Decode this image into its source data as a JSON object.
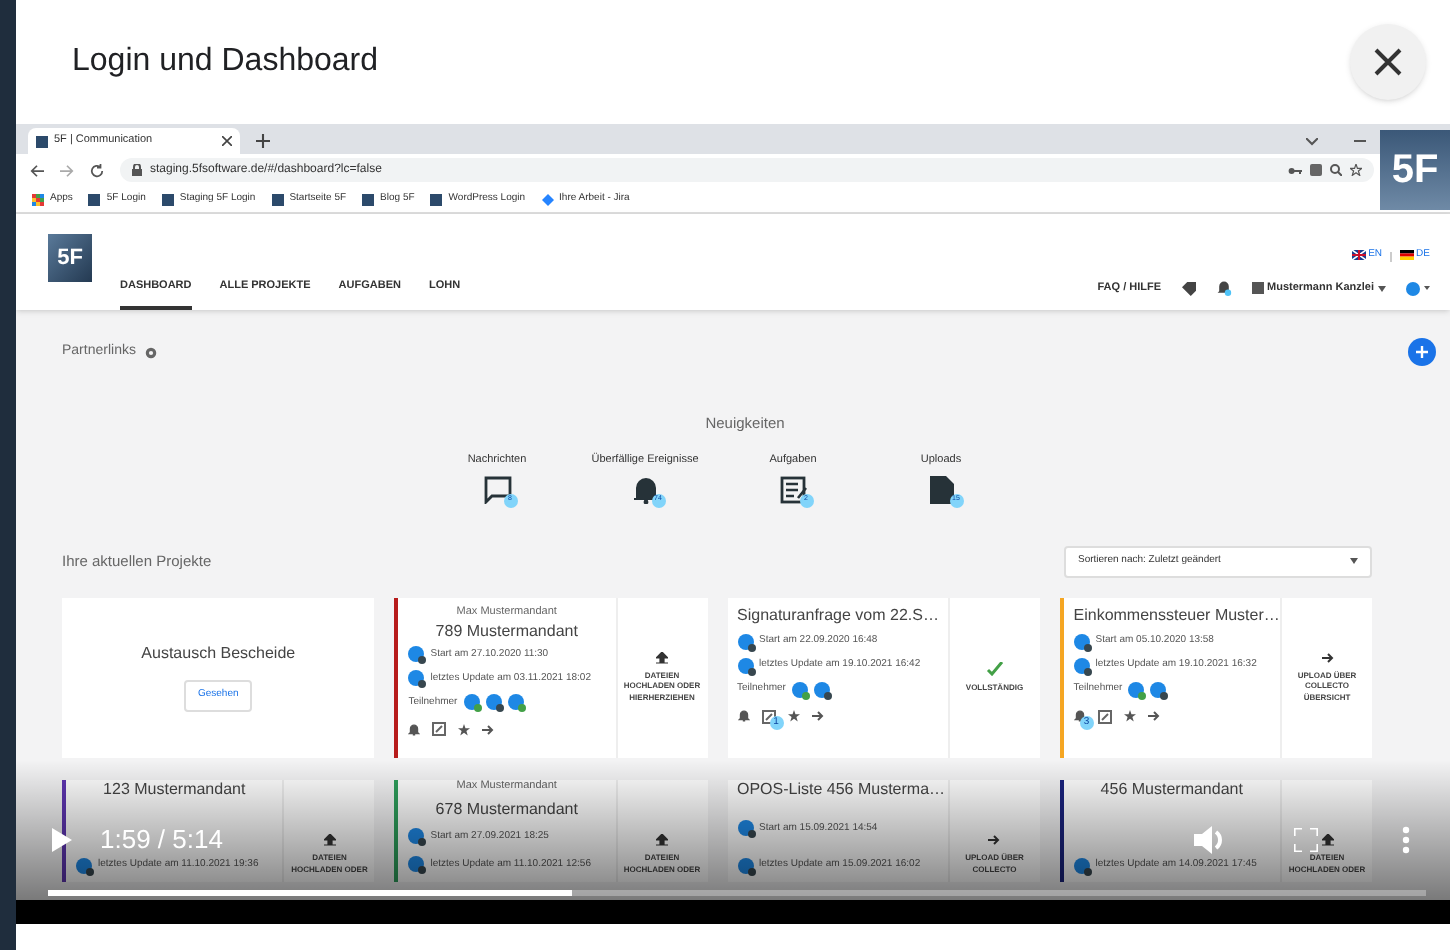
{
  "dialog": {
    "title": "Login und Dashboard"
  },
  "browser": {
    "tab_title": "5F | Communication",
    "url": "staging.5fsoftware.de/#/dashboard?lc=false",
    "bookmarks": [
      {
        "label": "Apps",
        "kind": "apps"
      },
      {
        "label": "5F Login",
        "kind": "site"
      },
      {
        "label": "Staging 5F Login",
        "kind": "site"
      },
      {
        "label": "Startseite 5F",
        "kind": "site"
      },
      {
        "label": "Blog 5F",
        "kind": "site"
      },
      {
        "label": "WordPress Login",
        "kind": "site"
      },
      {
        "label": "Ihre Arbeit - Jira",
        "kind": "jira"
      }
    ]
  },
  "app": {
    "logo": "5F",
    "languages": [
      {
        "code": "EN",
        "kind": "uk"
      },
      {
        "code": "DE",
        "kind": "de"
      }
    ],
    "nav": [
      {
        "label": "DASHBOARD",
        "selected": true
      },
      {
        "label": "ALLE PROJEKTE",
        "selected": false
      },
      {
        "label": "AUFGABEN",
        "selected": false
      },
      {
        "label": "LOHN",
        "selected": false
      }
    ],
    "help": "FAQ / HILFE",
    "account": "Mustermann Kanzlei"
  },
  "partnerlinks": {
    "title": "Partnerlinks"
  },
  "news": {
    "title": "Neuigkeiten",
    "items": [
      {
        "label": "Nachrichten",
        "kind": "messages",
        "count": "8"
      },
      {
        "label": "Überfällige Ereignisse",
        "kind": "alerts",
        "count": "74"
      },
      {
        "label": "Aufgaben",
        "kind": "tasks",
        "count": "2"
      },
      {
        "label": "Uploads",
        "kind": "uploads",
        "count": "15"
      }
    ]
  },
  "projects": {
    "title": "Ihre aktuellen Projekte",
    "sort": "Sortieren nach: Zuletzt geändert",
    "cards": [
      {
        "kind": "note",
        "title": "Austausch Bescheide",
        "button": "Gesehen"
      },
      {
        "kind": "client",
        "color": "#b71c1c",
        "subtitle": "Max Mustermandant",
        "title": "789 Mustermandant",
        "start": "Start am 27.10.2020 11:30",
        "update": "letztes Update am 03.11.2021 18:02",
        "participants_label": "Teilnehmer",
        "participants": [
          {
            "confirmed": true
          },
          {
            "confirmed": false
          },
          {
            "confirmed": true
          }
        ],
        "footer": true,
        "action": {
          "kind": "upload",
          "label": "DATEIEN HOCHLADEN ODER HIERHERZIEHEN"
        }
      },
      {
        "kind": "document",
        "title": "Signaturanfrage vom 22.S…",
        "start": "Start am 22.09.2020 16:48",
        "update": "letztes Update am 19.10.2021 16:42",
        "participants_label": "Teilnehmer",
        "participants": [
          {
            "confirmed": true
          },
          {
            "confirmed": false
          }
        ],
        "footer": true,
        "task_badge": "1",
        "action": {
          "kind": "complete",
          "label": "VOLLSTÄNDIG"
        }
      },
      {
        "kind": "document",
        "color": "#f5a623",
        "title": "Einkommenssteuer Muster…",
        "start": "Start am 05.10.2020 13:58",
        "update": "letztes Update am 19.10.2021 16:32",
        "participants_label": "Teilnehmer",
        "participants": [
          {
            "confirmed": true
          },
          {
            "confirmed": false
          }
        ],
        "footer": true,
        "bell_badge": "3",
        "action": {
          "kind": "collecto",
          "label": "UPLOAD ÜBER COLLECTO ÜBERSICHT"
        }
      },
      {
        "kind": "client",
        "color": "#5e35b1",
        "title": "123 Mustermandant",
        "update": "letztes Update am 11.10.2021 19:36",
        "action": {
          "kind": "upload",
          "label": "DATEIEN HOCHLADEN ODER"
        }
      },
      {
        "kind": "client",
        "color": "#2e9e5b",
        "subtitle": "Max Mustermandant",
        "title": "678 Mustermandant",
        "start": "Start am 27.09.2021 18:25",
        "update": "letztes Update am 11.10.2021 12:56",
        "action": {
          "kind": "upload",
          "label": "DATEIEN HOCHLADEN ODER"
        }
      },
      {
        "kind": "document",
        "title": "OPOS-Liste 456 Musterma…",
        "start": "Start am 15.09.2021 14:54",
        "update": "letztes Update am 15.09.2021 16:02",
        "action": {
          "kind": "collecto",
          "label": "UPLOAD ÜBER COLLECTO"
        }
      },
      {
        "kind": "client",
        "color": "#1a237e",
        "title": "456 Mustermandant",
        "update": "letztes Update am 14.09.2021 17:45",
        "action": {
          "kind": "upload",
          "label": "DATEIEN HOCHLADEN ODER"
        }
      }
    ]
  },
  "player": {
    "time": "1:59 / 5:14",
    "level": 0.38,
    "watermark": "5F"
  }
}
